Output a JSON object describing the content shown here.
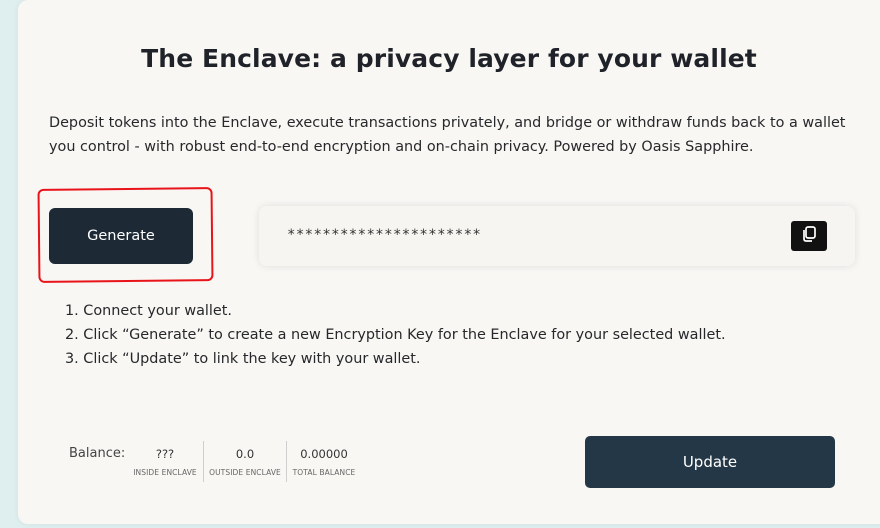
{
  "page": {
    "title": "The Enclave: a privacy layer for your wallet",
    "description": "Deposit tokens into the Enclave, execute transactions privately, and bridge or withdraw funds back to a wallet you control - with robust end-to-end encryption and on-chain privacy. Powered by Oasis Sapphire."
  },
  "key": {
    "generate_label": "Generate",
    "masked_value": "**********************",
    "copy_icon": "copy-icon"
  },
  "steps": [
    "1. Connect your wallet.",
    "2. Click “Generate” to create a new Encryption Key for the Enclave for your selected wallet.",
    "3. Click “Update” to link the key with your wallet."
  ],
  "balance": {
    "label": "Balance:",
    "inside": {
      "value": "???",
      "caption": "INSIDE ENCLAVE"
    },
    "outside": {
      "value": "0.0",
      "caption": "OUTSIDE ENCLAVE"
    },
    "total": {
      "value": "0.00000",
      "caption": "TOTAL BALANCE"
    }
  },
  "actions": {
    "update_label": "Update"
  },
  "colors": {
    "button_dark": "#1d2a36",
    "update_button": "#243747",
    "highlight_red": "#e8141a",
    "card_bg": "#f9f7f4"
  }
}
